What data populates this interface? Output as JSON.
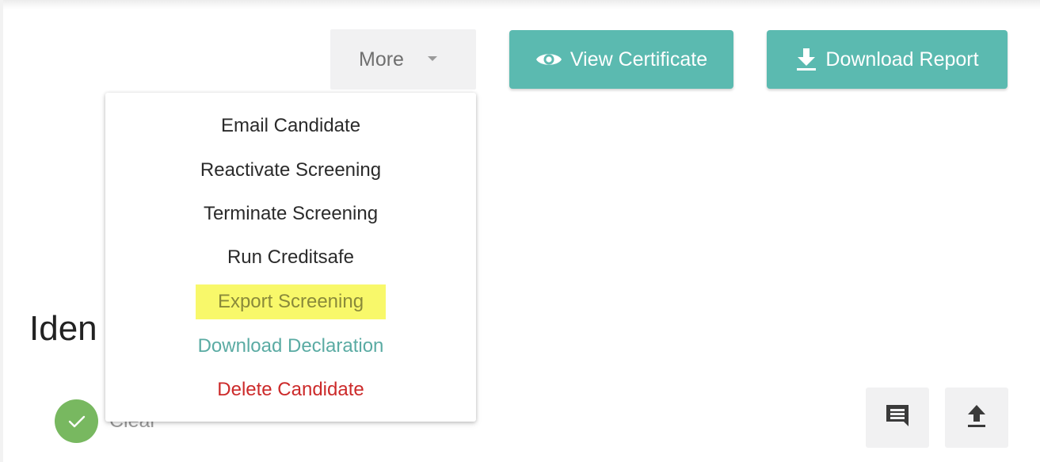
{
  "header": {
    "more_label": "More",
    "view_certificate_label": "View Certificate",
    "download_report_label": "Download Report"
  },
  "dropdown": {
    "items": [
      {
        "label": "Email Candidate"
      },
      {
        "label": "Reactivate Screening"
      },
      {
        "label": "Terminate Screening"
      },
      {
        "label": "Run Creditsafe"
      },
      {
        "label": "Export Screening",
        "highlighted": true
      },
      {
        "label": "Download Declaration"
      },
      {
        "label": "Delete Candidate"
      }
    ]
  },
  "section": {
    "heading_visible": "Iden",
    "status_text": "Clear"
  },
  "icons": {
    "more_caret": "caret-down-icon",
    "view_certificate": "eye-icon",
    "download_report": "download-icon",
    "status": "check-icon",
    "comment": "comment-icon",
    "upload": "upload-icon"
  },
  "colors": {
    "accent": "#5bbab0",
    "button_bg": "#f1f1f2",
    "status_green": "#78b860",
    "highlight": "#f8f86a",
    "danger": "#cc2a2a",
    "link_teal": "#5aaba3"
  }
}
